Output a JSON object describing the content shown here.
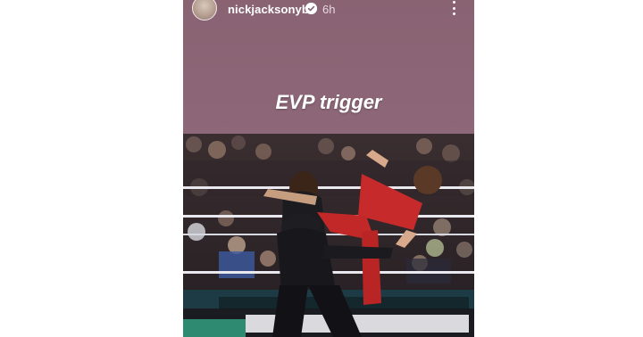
{
  "story": {
    "username": "nickjacksonyb",
    "timestamp": "6h",
    "caption": "EVP trigger"
  },
  "icons": {
    "verified": "verified-badge-icon",
    "more": "more-options-icon",
    "avatar": "profile-avatar"
  },
  "colors": {
    "story_background": "#8a6373",
    "text": "#ffffff"
  },
  "photo": {
    "description_free": true
  }
}
